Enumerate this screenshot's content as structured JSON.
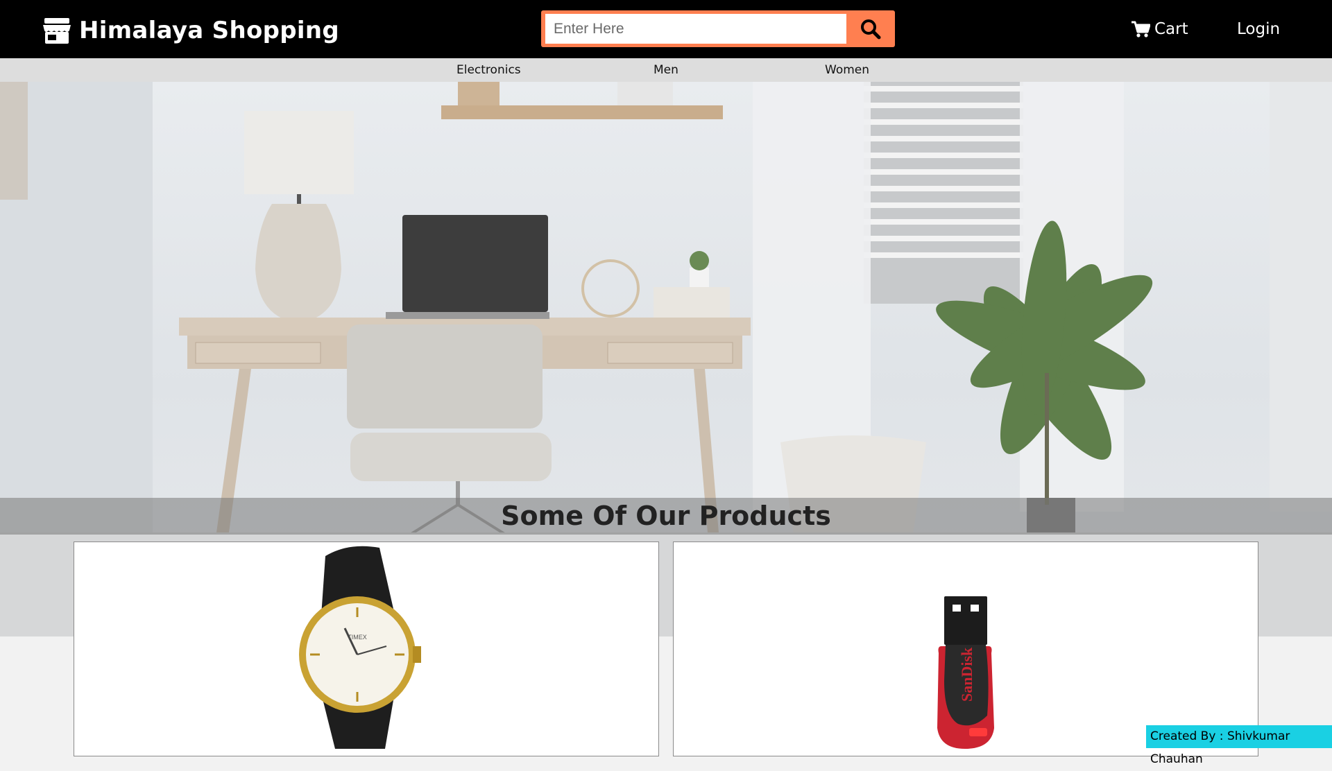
{
  "header": {
    "brand_title": "Himalaya Shopping",
    "brand_icon": "store-icon",
    "search": {
      "placeholder": "Enter Here",
      "value": "",
      "button_icon": "search-icon"
    },
    "cart_label": "Cart",
    "cart_icon": "cart-icon",
    "login_label": "Login"
  },
  "categories": [
    "Electronics",
    "Men",
    "Women"
  ],
  "hero": {
    "section_title": "Some Of Our Products"
  },
  "products": [
    {
      "image": "wrist-watch-image",
      "brand_mark": "TIMEX"
    },
    {
      "image": "usb-flash-drive-image",
      "brand_mark": "SanDisk"
    }
  ],
  "footer": {
    "credit": "Created By : Shivkumar Chauhan"
  },
  "colors": {
    "header_bg": "#000000",
    "accent": "#ff7f50",
    "category_bar": "#dddddd",
    "credit_bg": "#1ad0e3"
  }
}
